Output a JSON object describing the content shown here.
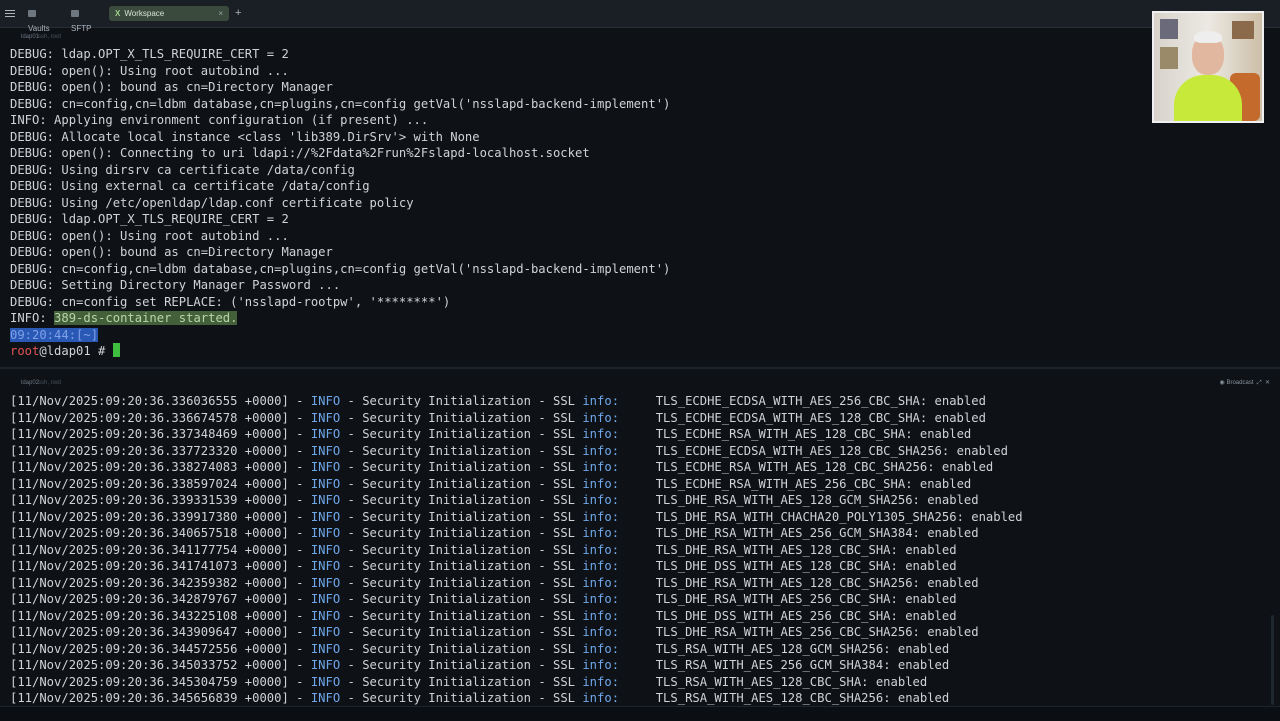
{
  "topbar": {
    "tabs": [
      {
        "label": "Vaults",
        "icon": "vault-icon"
      },
      {
        "label": "SFTP",
        "icon": "folder-icon"
      },
      {
        "label": "Workspace",
        "icon": "workspace-icon",
        "active": true
      }
    ],
    "add_label": "+",
    "close_label": "×"
  },
  "pane1": {
    "host": "ldap01",
    "sub": "ssh, root",
    "lines": [
      "DEBUG: ldap.OPT_X_TLS_REQUIRE_CERT = 2",
      "DEBUG: open(): Using root autobind ...",
      "DEBUG: open(): bound as cn=Directory Manager",
      "DEBUG: cn=config,cn=ldbm database,cn=plugins,cn=config getVal('nsslapd-backend-implement')",
      "INFO: Applying environment configuration (if present) ...",
      "DEBUG: Allocate local instance <class 'lib389.DirSrv'> with None",
      "DEBUG: open(): Connecting to uri ldapi://%2Fdata%2Frun%2Fslapd-localhost.socket",
      "DEBUG: Using dirsrv ca certificate /data/config",
      "DEBUG: Using external ca certificate /data/config",
      "DEBUG: Using /etc/openldap/ldap.conf certificate policy",
      "DEBUG: ldap.OPT_X_TLS_REQUIRE_CERT = 2",
      "DEBUG: open(): Using root autobind ...",
      "DEBUG: open(): bound as cn=Directory Manager",
      "DEBUG: cn=config,cn=ldbm database,cn=plugins,cn=config getVal('nsslapd-backend-implement')",
      "DEBUG: Setting Directory Manager Password ...",
      "DEBUG: cn=config set REPLACE: ('nsslapd-rootpw', '********')"
    ],
    "info_prefix": "INFO: ",
    "info_highlight": "389-ds-container started.",
    "time_line": "09:20:44:[~]",
    "prompt_user": "root",
    "prompt_host": "@ldap01 # "
  },
  "pane2": {
    "host": "ldap02",
    "sub": "ssh, root",
    "broadcast_label": "Broadcast",
    "log": {
      "level": "INFO",
      "dash": " - ",
      "message": "Security Initialization - SSL ",
      "info_word": "info:",
      "status": ": enabled",
      "rows": [
        {
          "ts": "[11/Nov/2025:09:20:36.336036555 +0000]",
          "cipher": "TLS_ECDHE_ECDSA_WITH_AES_256_CBC_SHA"
        },
        {
          "ts": "[11/Nov/2025:09:20:36.336674578 +0000]",
          "cipher": "TLS_ECDHE_ECDSA_WITH_AES_128_CBC_SHA"
        },
        {
          "ts": "[11/Nov/2025:09:20:36.337348469 +0000]",
          "cipher": "TLS_ECDHE_RSA_WITH_AES_128_CBC_SHA"
        },
        {
          "ts": "[11/Nov/2025:09:20:36.337723320 +0000]",
          "cipher": "TLS_ECDHE_ECDSA_WITH_AES_128_CBC_SHA256"
        },
        {
          "ts": "[11/Nov/2025:09:20:36.338274083 +0000]",
          "cipher": "TLS_ECDHE_RSA_WITH_AES_128_CBC_SHA256"
        },
        {
          "ts": "[11/Nov/2025:09:20:36.338597024 +0000]",
          "cipher": "TLS_ECDHE_RSA_WITH_AES_256_CBC_SHA"
        },
        {
          "ts": "[11/Nov/2025:09:20:36.339331539 +0000]",
          "cipher": "TLS_DHE_RSA_WITH_AES_128_GCM_SHA256"
        },
        {
          "ts": "[11/Nov/2025:09:20:36.339917380 +0000]",
          "cipher": "TLS_DHE_RSA_WITH_CHACHA20_POLY1305_SHA256"
        },
        {
          "ts": "[11/Nov/2025:09:20:36.340657518 +0000]",
          "cipher": "TLS_DHE_RSA_WITH_AES_256_GCM_SHA384"
        },
        {
          "ts": "[11/Nov/2025:09:20:36.341177754 +0000]",
          "cipher": "TLS_DHE_RSA_WITH_AES_128_CBC_SHA"
        },
        {
          "ts": "[11/Nov/2025:09:20:36.341741073 +0000]",
          "cipher": "TLS_DHE_DSS_WITH_AES_128_CBC_SHA"
        },
        {
          "ts": "[11/Nov/2025:09:20:36.342359382 +0000]",
          "cipher": "TLS_DHE_RSA_WITH_AES_128_CBC_SHA256"
        },
        {
          "ts": "[11/Nov/2025:09:20:36.342879767 +0000]",
          "cipher": "TLS_DHE_RSA_WITH_AES_256_CBC_SHA"
        },
        {
          "ts": "[11/Nov/2025:09:20:36.343225108 +0000]",
          "cipher": "TLS_DHE_DSS_WITH_AES_256_CBC_SHA"
        },
        {
          "ts": "[11/Nov/2025:09:20:36.343909647 +0000]",
          "cipher": "TLS_DHE_RSA_WITH_AES_256_CBC_SHA256"
        },
        {
          "ts": "[11/Nov/2025:09:20:36.344572556 +0000]",
          "cipher": "TLS_RSA_WITH_AES_128_GCM_SHA256"
        },
        {
          "ts": "[11/Nov/2025:09:20:36.345033752 +0000]",
          "cipher": "TLS_RSA_WITH_AES_256_GCM_SHA384"
        },
        {
          "ts": "[11/Nov/2025:09:20:36.345304759 +0000]",
          "cipher": "TLS_RSA_WITH_AES_128_CBC_SHA"
        },
        {
          "ts": "[11/Nov/2025:09:20:36.345656839 +0000]",
          "cipher": "TLS_RSA_WITH_AES_128_CBC_SHA256"
        }
      ]
    }
  },
  "colors": {
    "info_blue": "#6ea7ea",
    "highlight_green": "#43603a",
    "selection_blue": "#2a58b5",
    "prompt_red": "#e05252",
    "cursor_green": "#3fbf3f"
  }
}
